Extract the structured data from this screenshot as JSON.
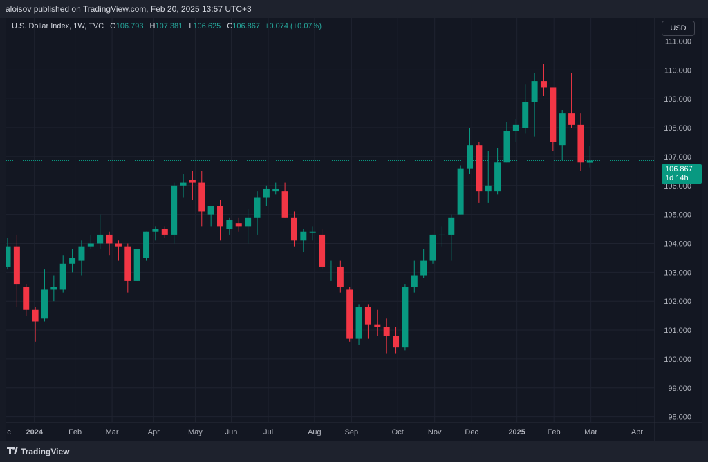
{
  "header": {
    "published_text": "aloisov published on TradingView.com, Feb 20, 2025 13:57 UTC+3"
  },
  "legend": {
    "symbol": "U.S. Dollar Index, 1W, TVC",
    "o_label": "O",
    "o_value": "106.793",
    "h_label": "H",
    "h_value": "107.381",
    "l_label": "L",
    "l_value": "106.625",
    "c_label": "C",
    "c_value": "106.867",
    "change": "+0.074 (+0.07%)"
  },
  "currency_button": "USD",
  "price_tag": {
    "price": "106.867",
    "countdown": "1d 14h"
  },
  "footer": {
    "brand": "TradingView"
  },
  "colors": {
    "up": "#089981",
    "down": "#f23645",
    "background": "#131722",
    "grid": "#1e222d"
  },
  "chart_data": {
    "type": "candlestick",
    "ylim": [
      97.8,
      111.8
    ],
    "y_ticks": [
      "98.000",
      "99.000",
      "100.000",
      "101.000",
      "102.000",
      "103.000",
      "104.000",
      "105.000",
      "106.000",
      "107.000",
      "108.000",
      "109.000",
      "110.000",
      "111.000"
    ],
    "x_labels": [
      {
        "label": "c",
        "i": -1.5
      },
      {
        "label": "2024",
        "i": 2.9
      },
      {
        "label": "Feb",
        "i": 7.3
      },
      {
        "label": "Mar",
        "i": 11.3
      },
      {
        "label": "Apr",
        "i": 15.8
      },
      {
        "label": "May",
        "i": 20.3
      },
      {
        "label": "Jun",
        "i": 24.2
      },
      {
        "label": "Jul",
        "i": 28.2
      },
      {
        "label": "Aug",
        "i": 33.2
      },
      {
        "label": "Sep",
        "i": 37.2
      },
      {
        "label": "Oct",
        "i": 42.2
      },
      {
        "label": "Nov",
        "i": 46.2
      },
      {
        "label": "Dec",
        "i": 50.2
      },
      {
        "label": "2025",
        "i": 55.1
      },
      {
        "label": "Feb",
        "i": 59.1
      },
      {
        "label": "Mar",
        "i": 63.1
      },
      {
        "label": "Apr",
        "i": 68.1
      }
    ],
    "last_price": 106.867,
    "candles": [
      {
        "o": 103.2,
        "h": 104.2,
        "l": 103.1,
        "c": 103.9
      },
      {
        "o": 103.9,
        "h": 104.3,
        "l": 101.8,
        "c": 102.6
      },
      {
        "o": 102.5,
        "h": 102.6,
        "l": 101.5,
        "c": 101.7
      },
      {
        "o": 101.7,
        "h": 101.8,
        "l": 100.6,
        "c": 101.3
      },
      {
        "o": 101.4,
        "h": 103.1,
        "l": 101.3,
        "c": 102.4
      },
      {
        "o": 102.4,
        "h": 102.9,
        "l": 102.0,
        "c": 102.5
      },
      {
        "o": 102.4,
        "h": 103.6,
        "l": 102.3,
        "c": 103.3
      },
      {
        "o": 103.3,
        "h": 103.8,
        "l": 103.0,
        "c": 103.5
      },
      {
        "o": 103.4,
        "h": 104.1,
        "l": 102.9,
        "c": 103.9
      },
      {
        "o": 103.9,
        "h": 104.3,
        "l": 103.8,
        "c": 104.0
      },
      {
        "o": 104.0,
        "h": 105.0,
        "l": 103.8,
        "c": 104.3
      },
      {
        "o": 104.3,
        "h": 104.4,
        "l": 103.6,
        "c": 104.0
      },
      {
        "o": 104.0,
        "h": 104.1,
        "l": 103.4,
        "c": 103.9
      },
      {
        "o": 103.9,
        "h": 104.0,
        "l": 102.3,
        "c": 102.7
      },
      {
        "o": 102.7,
        "h": 103.8,
        "l": 102.7,
        "c": 103.8
      },
      {
        "o": 103.5,
        "h": 104.4,
        "l": 103.4,
        "c": 104.4
      },
      {
        "o": 104.4,
        "h": 104.6,
        "l": 104.1,
        "c": 104.5
      },
      {
        "o": 104.5,
        "h": 104.6,
        "l": 104.2,
        "c": 104.3
      },
      {
        "o": 104.3,
        "h": 106.1,
        "l": 104.0,
        "c": 106.0
      },
      {
        "o": 106.0,
        "h": 106.4,
        "l": 105.6,
        "c": 106.1
      },
      {
        "o": 106.2,
        "h": 106.5,
        "l": 105.5,
        "c": 106.1
      },
      {
        "o": 106.1,
        "h": 106.5,
        "l": 104.6,
        "c": 105.1
      },
      {
        "o": 105.0,
        "h": 105.3,
        "l": 104.6,
        "c": 105.3
      },
      {
        "o": 105.3,
        "h": 105.5,
        "l": 104.1,
        "c": 104.6
      },
      {
        "o": 104.5,
        "h": 104.9,
        "l": 104.3,
        "c": 104.8
      },
      {
        "o": 104.7,
        "h": 104.9,
        "l": 104.4,
        "c": 104.6
      },
      {
        "o": 104.6,
        "h": 105.2,
        "l": 104.0,
        "c": 104.9
      },
      {
        "o": 104.9,
        "h": 105.8,
        "l": 104.3,
        "c": 105.6
      },
      {
        "o": 105.6,
        "h": 106.0,
        "l": 105.3,
        "c": 105.9
      },
      {
        "o": 105.8,
        "h": 106.1,
        "l": 105.7,
        "c": 105.9
      },
      {
        "o": 105.8,
        "h": 106.1,
        "l": 104.9,
        "c": 104.9
      },
      {
        "o": 104.9,
        "h": 105.1,
        "l": 103.9,
        "c": 104.1
      },
      {
        "o": 104.1,
        "h": 104.5,
        "l": 103.7,
        "c": 104.4
      },
      {
        "o": 104.4,
        "h": 104.6,
        "l": 104.1,
        "c": 104.4
      },
      {
        "o": 104.3,
        "h": 104.5,
        "l": 103.1,
        "c": 103.2
      },
      {
        "o": 103.2,
        "h": 103.4,
        "l": 102.7,
        "c": 103.2
      },
      {
        "o": 103.2,
        "h": 103.4,
        "l": 102.3,
        "c": 102.5
      },
      {
        "o": 102.4,
        "h": 102.5,
        "l": 100.6,
        "c": 100.7
      },
      {
        "o": 100.7,
        "h": 101.9,
        "l": 100.5,
        "c": 101.8
      },
      {
        "o": 101.8,
        "h": 101.9,
        "l": 100.7,
        "c": 101.2
      },
      {
        "o": 101.2,
        "h": 101.7,
        "l": 100.8,
        "c": 101.1
      },
      {
        "o": 101.1,
        "h": 101.4,
        "l": 100.2,
        "c": 100.8
      },
      {
        "o": 100.8,
        "h": 101.1,
        "l": 100.2,
        "c": 100.4
      },
      {
        "o": 100.4,
        "h": 102.6,
        "l": 100.3,
        "c": 102.5
      },
      {
        "o": 102.5,
        "h": 103.4,
        "l": 102.3,
        "c": 102.9
      },
      {
        "o": 102.9,
        "h": 103.8,
        "l": 102.8,
        "c": 103.4
      },
      {
        "o": 103.4,
        "h": 104.3,
        "l": 103.3,
        "c": 104.3
      },
      {
        "o": 104.3,
        "h": 104.6,
        "l": 103.9,
        "c": 104.3
      },
      {
        "o": 104.3,
        "h": 105.0,
        "l": 103.4,
        "c": 104.9
      },
      {
        "o": 105.0,
        "h": 106.7,
        "l": 105.0,
        "c": 106.6
      },
      {
        "o": 106.6,
        "h": 108.0,
        "l": 106.4,
        "c": 107.4
      },
      {
        "o": 107.4,
        "h": 107.5,
        "l": 105.4,
        "c": 105.8
      },
      {
        "o": 105.8,
        "h": 107.2,
        "l": 105.4,
        "c": 106.0
      },
      {
        "o": 105.8,
        "h": 107.3,
        "l": 105.7,
        "c": 106.8
      },
      {
        "o": 106.8,
        "h": 108.2,
        "l": 106.8,
        "c": 107.9
      },
      {
        "o": 107.9,
        "h": 108.3,
        "l": 107.5,
        "c": 108.1
      },
      {
        "o": 108.0,
        "h": 109.5,
        "l": 107.8,
        "c": 108.9
      },
      {
        "o": 108.9,
        "h": 109.9,
        "l": 107.7,
        "c": 109.6
      },
      {
        "o": 109.6,
        "h": 110.2,
        "l": 109.1,
        "c": 109.4
      },
      {
        "o": 109.4,
        "h": 109.4,
        "l": 107.2,
        "c": 107.5
      },
      {
        "o": 107.4,
        "h": 108.6,
        "l": 106.9,
        "c": 108.5
      },
      {
        "o": 108.5,
        "h": 109.9,
        "l": 108.0,
        "c": 108.1
      },
      {
        "o": 108.1,
        "h": 108.5,
        "l": 106.5,
        "c": 106.8
      },
      {
        "o": 106.793,
        "h": 107.381,
        "l": 106.625,
        "c": 106.867
      }
    ]
  }
}
